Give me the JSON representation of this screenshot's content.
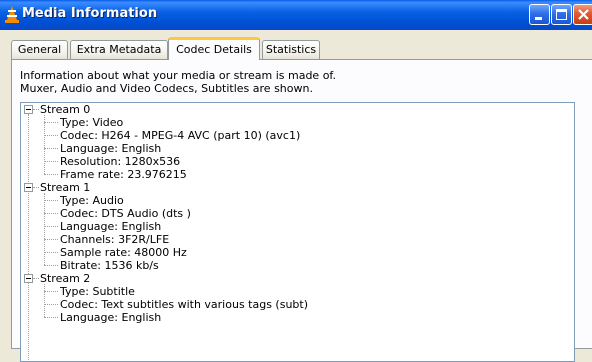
{
  "window": {
    "title": "Media Information"
  },
  "tabs": [
    "General",
    "Extra Metadata",
    "Codec Details",
    "Statistics"
  ],
  "description": {
    "line1": "Information about what your media or stream is made of.",
    "line2": "Muxer, Audio and Video Codecs, Subtitles are shown."
  },
  "streams": [
    {
      "name": "Stream 0",
      "details": [
        "Type: Video",
        "Codec: H264 - MPEG-4 AVC (part 10) (avc1)",
        "Language: English",
        "Resolution: 1280x536",
        "Frame rate: 23.976215"
      ]
    },
    {
      "name": "Stream 1",
      "details": [
        "Type: Audio",
        "Codec: DTS Audio (dts )",
        "Language: English",
        "Channels: 3F2R/LFE",
        "Sample rate: 48000 Hz",
        "Bitrate: 1536 kb/s"
      ]
    },
    {
      "name": "Stream 2",
      "details": [
        "Type: Subtitle",
        "Codec: Text subtitles with various tags (subt)",
        "Language: English"
      ]
    }
  ],
  "colors": {
    "titlebar": "#0052d6",
    "active_tab_accent": "#ffc83c",
    "close_button": "#e2582f"
  },
  "icons": {
    "app": "vlc-cone-icon",
    "minimize": "minimize-icon",
    "maximize": "maximize-icon",
    "close": "close-icon"
  }
}
